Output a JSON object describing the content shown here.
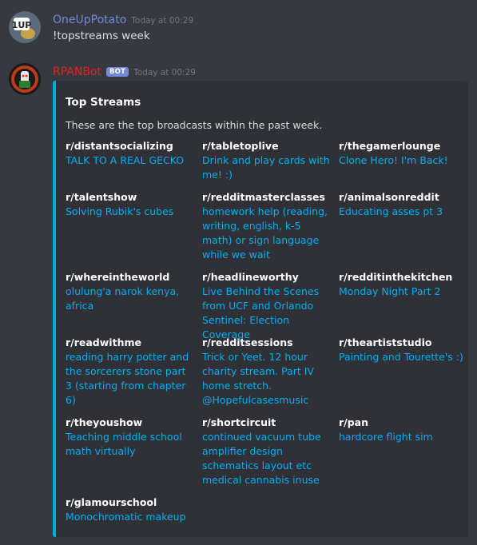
{
  "messages": [
    {
      "username": "OneUpPotato",
      "username_color": "#7289da",
      "timestamp": "Today at 00:29",
      "content": "!topstreams week",
      "avatar_badge": "1UP"
    },
    {
      "username": "RPANBot",
      "username_color": "#e91e1e",
      "bot_tag": "BOT",
      "timestamp": "Today at 00:29"
    }
  ],
  "embed": {
    "accent_color": "#00aeda",
    "title": "Top Streams",
    "description": "These are the top broadcasts within the past week.",
    "fields": [
      {
        "name": "r/distantsocializing",
        "value": "TALK TO A REAL GECKO"
      },
      {
        "name": "r/tabletoplive",
        "value": "Drink and play cards with me! :)"
      },
      {
        "name": "r/thegamerlounge",
        "value": "Clone Hero! I'm Back!"
      },
      {
        "name": "r/talentshow",
        "value": "Solving Rubik's cubes"
      },
      {
        "name": "r/redditmasterclasses",
        "value": "homework help (reading, writing, english, k-5 math) or sign language while we wait"
      },
      {
        "name": "r/animalsonreddit",
        "value": "Educating asses pt 3"
      },
      {
        "name": "r/whereintheworld",
        "value": "olulung'a narok kenya, africa"
      },
      {
        "name": "r/headlineworthy",
        "value": "Live Behind the Scenes from UCF and Orlando Sentinel: Election Coverage"
      },
      {
        "name": "r/redditinthekitchen",
        "value": "Monday Night Part 2"
      },
      {
        "name": "r/readwithme",
        "value": "reading harry potter and the sorcerers stone part 3 (starting from chapter 6)"
      },
      {
        "name": "r/redditsessions",
        "value": "Trick or Yeet. 12 hour charity stream. Part IV home stretch. @Hopefulcasesmusic"
      },
      {
        "name": "r/theartiststudio",
        "value": "Painting and Tourette's :)"
      },
      {
        "name": "r/theyoushow",
        "value": "Teaching middle school math virtually"
      },
      {
        "name": "r/shortcircuit",
        "value": "continued vacuum tube amplifier design schematics layout etc medical cannabis inuse"
      },
      {
        "name": "r/pan",
        "value": "hardcore flight sim"
      },
      {
        "name": "r/glamourschool",
        "value": "Monochromatic makeup"
      }
    ]
  }
}
